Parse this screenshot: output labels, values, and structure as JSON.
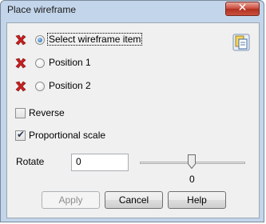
{
  "window": {
    "title": "Place wireframe",
    "close_label": "✕"
  },
  "selection": {
    "items": [
      {
        "label": "Select wireframe item",
        "status": "red-x-icon",
        "selected": true
      },
      {
        "label": "Position 1",
        "status": "red-x-icon",
        "selected": false
      },
      {
        "label": "Position 2",
        "status": "red-x-icon",
        "selected": false
      }
    ]
  },
  "options": {
    "reverse_label": "Reverse",
    "reverse_checked": false,
    "proportional_label": "Proportional scale",
    "proportional_checked": true
  },
  "rotate": {
    "label": "Rotate",
    "value": "0",
    "slider_value": "0"
  },
  "buttons": {
    "apply": "Apply",
    "cancel": "Cancel",
    "help": "Help"
  },
  "colors": {
    "frame": "#c3d5ea",
    "status_red": "#cc1f1f",
    "close_red": "#c9473a"
  }
}
